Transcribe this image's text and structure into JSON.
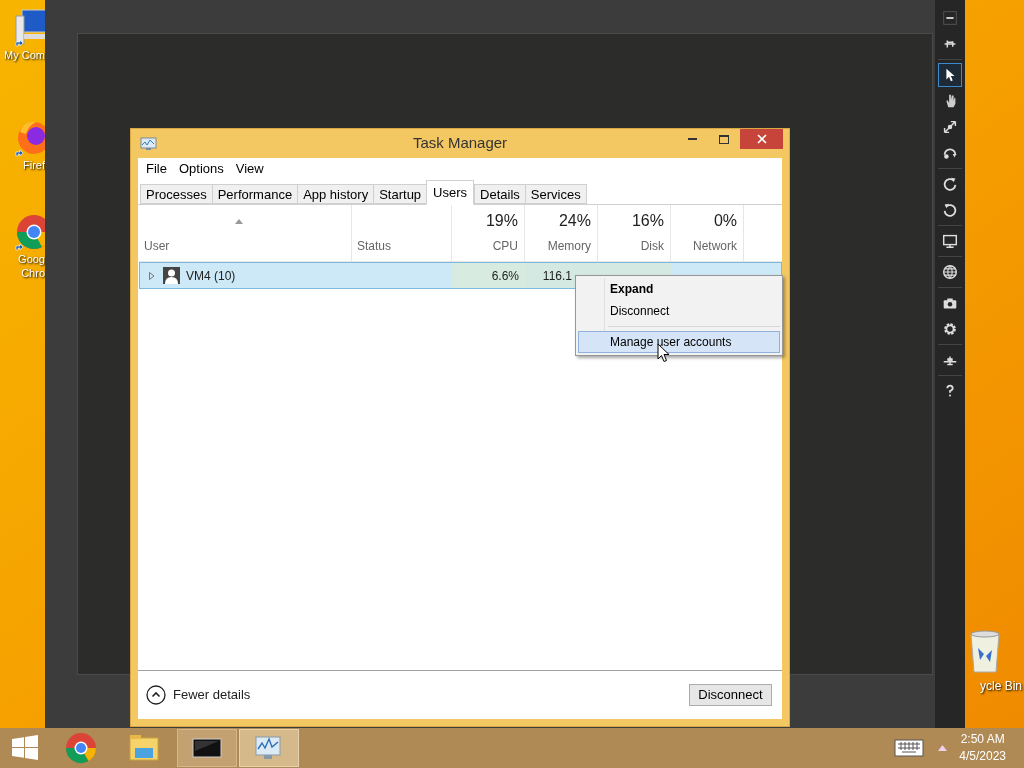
{
  "desktop_icons": [
    {
      "kind": "computer",
      "label": "My Com"
    },
    {
      "kind": "firefox",
      "label": "Firef"
    },
    {
      "kind": "chrome",
      "label": "Goog\nChro"
    }
  ],
  "recycle_bin": {
    "label": "ycle Bin"
  },
  "viewer_toolbar": [
    {
      "kind": "minimize",
      "selected": false
    },
    {
      "kind": "pin",
      "selected": false
    },
    {
      "kind": "pointer",
      "selected": true
    },
    {
      "kind": "hand",
      "selected": false
    },
    {
      "kind": "resize",
      "selected": false
    },
    {
      "kind": "swap",
      "selected": false
    },
    {
      "kind": "rotate-right",
      "selected": false
    },
    {
      "kind": "rotate-left",
      "selected": false
    },
    {
      "kind": "monitor",
      "selected": false
    },
    {
      "kind": "globe",
      "selected": false
    },
    {
      "kind": "camera",
      "selected": false
    },
    {
      "kind": "gear",
      "selected": false
    },
    {
      "kind": "network",
      "selected": false
    },
    {
      "kind": "help",
      "selected": false
    }
  ],
  "window": {
    "title": "Task Manager"
  },
  "menu": [
    "File",
    "Options",
    "View"
  ],
  "tabs": [
    {
      "label": "Processes",
      "selected": false
    },
    {
      "label": "Performance",
      "selected": false
    },
    {
      "label": "App history",
      "selected": false
    },
    {
      "label": "Startup",
      "selected": false
    },
    {
      "label": "Users",
      "selected": true
    },
    {
      "label": "Details",
      "selected": false
    },
    {
      "label": "Services",
      "selected": false
    }
  ],
  "columns": [
    {
      "label": "User",
      "sorted": true
    },
    {
      "label": "Status",
      "sorted": false
    },
    {
      "label": "CPU",
      "total": "19%",
      "sorted": false
    },
    {
      "label": "Memory",
      "total": "24%",
      "sorted": false
    },
    {
      "label": "Disk",
      "total": "16%",
      "sorted": false
    },
    {
      "label": "Network",
      "total": "0%",
      "sorted": false
    }
  ],
  "rows": [
    {
      "user": "VM4 (10)",
      "cpu": "6.6%",
      "memory": "116.1",
      "selected": true,
      "expanded": false
    }
  ],
  "context_menu": [
    {
      "kind": "item",
      "label": "Expand",
      "default": true,
      "selected": false
    },
    {
      "kind": "item",
      "label": "Disconnect",
      "default": false,
      "selected": false
    },
    {
      "kind": "separator"
    },
    {
      "kind": "item",
      "label": "Manage user accounts",
      "default": false,
      "selected": true
    }
  ],
  "footer": {
    "details_toggle": "Fewer details",
    "button": "Disconnect"
  },
  "taskbar": [
    {
      "kind": "start",
      "selected": false
    },
    {
      "kind": "chrome",
      "selected": false
    },
    {
      "kind": "explorer",
      "selected": false
    },
    {
      "kind": "remote",
      "selected": true
    },
    {
      "kind": "taskmgr",
      "selected": true
    }
  ],
  "clock": {
    "time": "2:50 AM",
    "date": "4/5/2023"
  }
}
